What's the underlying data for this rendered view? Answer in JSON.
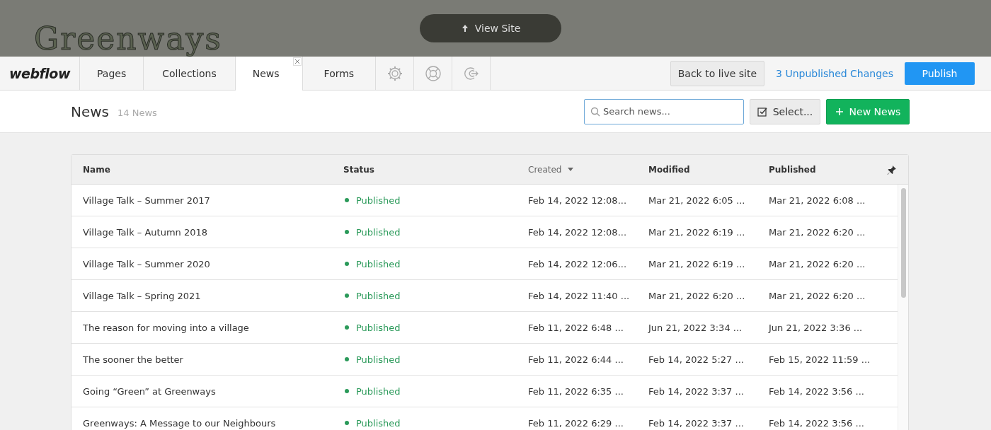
{
  "site_preview": {
    "logo_text": "Greenways",
    "view_site_button": "View Site"
  },
  "toolbar": {
    "brand": "webflow",
    "tabs": [
      {
        "label": "Pages",
        "selected": false,
        "closable": false
      },
      {
        "label": "Collections",
        "selected": false,
        "closable": false
      },
      {
        "label": "News",
        "selected": true,
        "closable": true
      },
      {
        "label": "Forms",
        "selected": false,
        "closable": false
      }
    ],
    "icon_tabs": [
      {
        "kind": "gear"
      },
      {
        "kind": "lifebuoy"
      },
      {
        "kind": "exit"
      }
    ],
    "back_button": "Back to live site",
    "changes_link": "3 Unpublished Changes",
    "publish_button": "Publish"
  },
  "header": {
    "title": "News",
    "count": "14 News",
    "search": {
      "placeholder": "Search news..."
    },
    "select_button": "Select...",
    "new_button": "New News"
  },
  "table": {
    "columns": [
      {
        "label": "Name",
        "sorted": false
      },
      {
        "label": "Status",
        "sorted": false
      },
      {
        "label": "Created",
        "sorted": true
      },
      {
        "label": "Modified",
        "sorted": false
      },
      {
        "label": "Published",
        "sorted": false
      }
    ],
    "rows": [
      {
        "name": "Village Talk – Summer 2017",
        "status": "Published",
        "created": "Feb 14, 2022 12:08...",
        "modified": "Mar 21, 2022 6:05 ...",
        "published": "Mar 21, 2022 6:08 ..."
      },
      {
        "name": "Village Talk – Autumn 2018",
        "status": "Published",
        "created": "Feb 14, 2022 12:08...",
        "modified": "Mar 21, 2022 6:19 ...",
        "published": "Mar 21, 2022 6:20 ..."
      },
      {
        "name": "Village Talk – Summer 2020",
        "status": "Published",
        "created": "Feb 14, 2022 12:06...",
        "modified": "Mar 21, 2022 6:19 ...",
        "published": "Mar 21, 2022 6:20 ..."
      },
      {
        "name": "Village Talk – Spring 2021",
        "status": "Published",
        "created": "Feb 14, 2022 11:40 ...",
        "modified": "Mar 21, 2022 6:20 ...",
        "published": "Mar 21, 2022 6:20 ..."
      },
      {
        "name": "The reason for moving into a village",
        "status": "Published",
        "created": "Feb 11, 2022 6:48 ...",
        "modified": "Jun 21, 2022 3:34 ...",
        "published": "Jun 21, 2022 3:36 ..."
      },
      {
        "name": "The sooner the better",
        "status": "Published",
        "created": "Feb 11, 2022 6:44 ...",
        "modified": "Feb 14, 2022 5:27 ...",
        "published": "Feb 15, 2022 11:59 ..."
      },
      {
        "name": "Going “Green” at Greenways",
        "status": "Published",
        "created": "Feb 11, 2022 6:35 ...",
        "modified": "Feb 14, 2022 3:37 ...",
        "published": "Feb 14, 2022 3:56 ..."
      },
      {
        "name": "Greenways: A Message to our Neighbours",
        "status": "Published",
        "created": "Feb 11, 2022 6:29 ...",
        "modified": "Feb 14, 2022 3:37 ...",
        "published": "Feb 14, 2022 3:56 ..."
      }
    ]
  }
}
